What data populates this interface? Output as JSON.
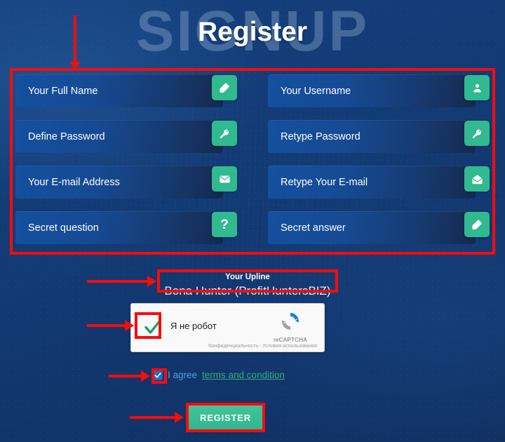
{
  "header": {
    "watermark": "SIGNUP",
    "title": "Register"
  },
  "form": {
    "rows": [
      {
        "left": {
          "placeholder": "Your Full Name",
          "icon": "edit-icon"
        },
        "right": {
          "placeholder": "Your Username",
          "icon": "user-icon"
        }
      },
      {
        "left": {
          "placeholder": "Define Password",
          "icon": "key-icon"
        },
        "right": {
          "placeholder": "Retype Password",
          "icon": "key-icon"
        }
      },
      {
        "left": {
          "placeholder": "Your E-mail Address",
          "icon": "mail-closed-icon"
        },
        "right": {
          "placeholder": "Retype Your E-mail",
          "icon": "mail-open-icon"
        }
      },
      {
        "left": {
          "placeholder": "Secret question",
          "icon": "question-mark-icon"
        },
        "right": {
          "placeholder": "Secret answer",
          "icon": "edit-icon"
        }
      }
    ]
  },
  "upline": {
    "label": "Your Upline",
    "value": "Bona Hunter (ProfitHuntersBIZ)"
  },
  "recaptcha": {
    "label": "Я не робот",
    "brand": "reCAPTCHA",
    "terms": "Конфиденциальность - Условия использования",
    "checked": true
  },
  "agree": {
    "text": "I agree",
    "link": "terms and condition",
    "checked": true
  },
  "submit": {
    "label": "REGISTER"
  },
  "colors": {
    "accent_green": "#31b990",
    "annotation_red": "#fb0b0b",
    "field_blue": "#14509e",
    "link_green": "#2fae7e",
    "agree_blue": "#4ba3e8"
  }
}
